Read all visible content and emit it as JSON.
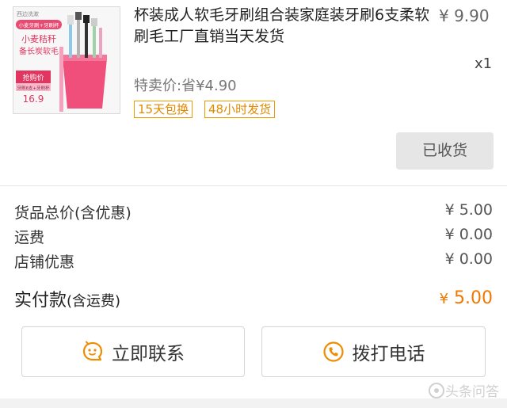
{
  "product": {
    "title": "杯装成人软毛牙刷组合装家庭装牙刷6支柔软刷毛工厂直销当天发货",
    "price": "¥ 9.90",
    "quantity": "x1",
    "sale_price": "特卖价:省¥4.90",
    "tags": [
      "15天包换",
      "48小时发货"
    ],
    "image": {
      "brand": "西边洗漱",
      "banner": "小麦牙刷+牙刷杯",
      "headline_1": "小麦秸秆",
      "headline_2": "备长炭软毛",
      "promo_label": "抢购价",
      "promo_sub": "牙刷6支+牙刷杯",
      "promo_price": "16.9"
    }
  },
  "status_button": "已收货",
  "summary": [
    {
      "label": "货品总价(含优惠)",
      "value": "¥ 5.00"
    },
    {
      "label": "运费",
      "value": "¥ 0.00"
    },
    {
      "label": "店铺优惠",
      "value": "¥ 0.00"
    }
  ],
  "total": {
    "label": "实付款",
    "label_note": "(含运费)",
    "currency": "¥",
    "amount": "5.00"
  },
  "actions": {
    "contact": "立即联系",
    "call": "拨打电话"
  },
  "watermark": "头条问答",
  "colors": {
    "accent": "#f07800",
    "tag_border": "#f09a00",
    "status_bg": "#e6e6e6"
  }
}
